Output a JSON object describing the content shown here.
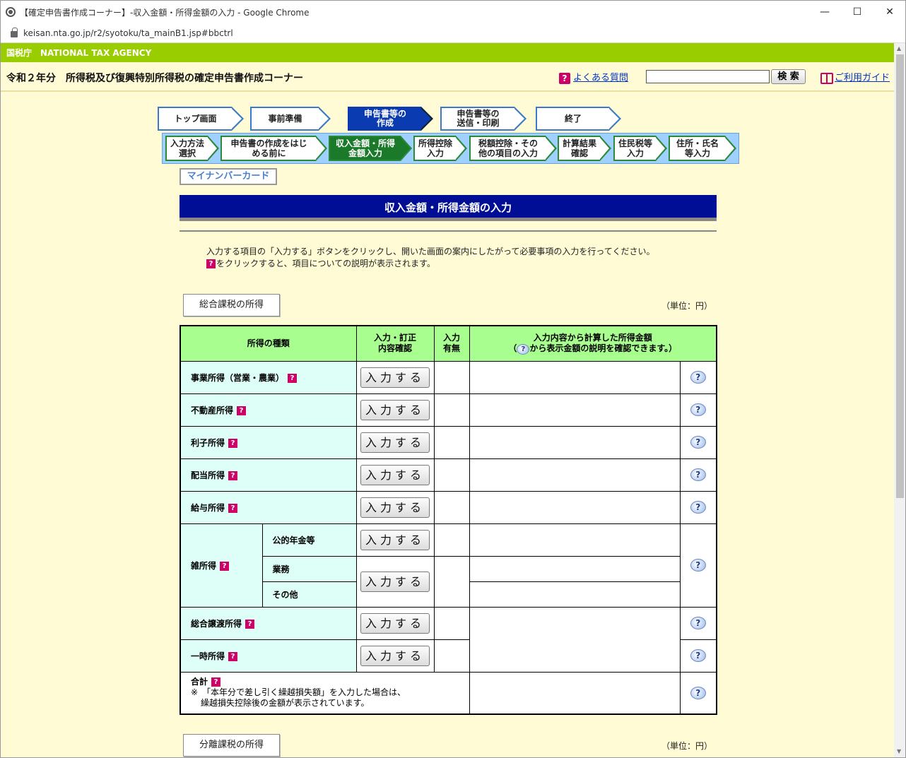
{
  "browser": {
    "tab_title": "【確定申告書作成コーナー】-収入金額・所得金額の入力 - Google Chrome",
    "url": "keisan.nta.go.jp/r2/syotoku/ta_mainB1.jsp#bbctrl",
    "minimize": "—",
    "maximize": "☐",
    "close": "✕"
  },
  "agency": {
    "jp": "国税庁",
    "en": "NATIONAL TAX AGENCY"
  },
  "header": {
    "title": "令和２年分　所得税及び復興特別所得税の確定申告書作成コーナー",
    "faq": "よくある質問",
    "search_btn": "検 索",
    "guide": "ご利用ガイド"
  },
  "steps": [
    "トップ画面",
    "事前準備",
    "申告書等の作成",
    "申告書等の送信・印刷",
    "終了"
  ],
  "step_lines": {
    "s3a": "申告書等の",
    "s3b": "作成",
    "s4a": "申告書等の",
    "s4b": "送信・印刷"
  },
  "substeps": {
    "a1": "入力方法",
    "a2": "選択",
    "b1": "申告書の作成をはじ",
    "b2": "める前に",
    "c1": "収入金額・所得",
    "c2": "金額入力",
    "d1": "所得控除",
    "d2": "入力",
    "e1": "税額控除・その",
    "e2": "他の項目の入力",
    "f1": "計算結果",
    "f2": "確認",
    "g1": "住民税等",
    "g2": "入力",
    "h1": "住所・氏名",
    "h2": "等入力"
  },
  "mynumber": "マイナンバーカード",
  "banner": "収入金額・所得金額の入力",
  "instruction": {
    "line1": "入力する項目の「入力する」ボタンをクリックし、開いた画面の案内にしたがって必要事項の入力を行ってください。",
    "line2": "をクリックすると、項目についての説明が表示されます。"
  },
  "section1": {
    "label": "総合課税の所得",
    "unit": "（単位：円）"
  },
  "section2": {
    "label": "分離課税の所得",
    "unit": "（単位：円）"
  },
  "table": {
    "h_type": "所得の種類",
    "h_input1": "入力・訂正",
    "h_input2": "内容確認",
    "h_has1": "入力",
    "h_has2": "有無",
    "h_amount1": "入力内容から計算した所得金額",
    "h_amount2a": "（",
    "h_amount2b": "から表示金額の説明を確認できます。）",
    "rows": {
      "r1": "事業所得（営業・農業）",
      "r2": "不動産所得",
      "r3": "利子所得",
      "r4": "配当所得",
      "r5": "給与所得",
      "misc": "雑所得",
      "m1": "公的年金等",
      "m2": "業務",
      "m3": "その他",
      "r6": "総合譲渡所得",
      "r7": "一時所得"
    },
    "total": "合計",
    "note1": "※　「本年分で差し引く繰越損失額」を入力した場合は、",
    "note2": "繰越損失控除後の金額が表示されています。",
    "btn": "入力する",
    "q": "?"
  }
}
